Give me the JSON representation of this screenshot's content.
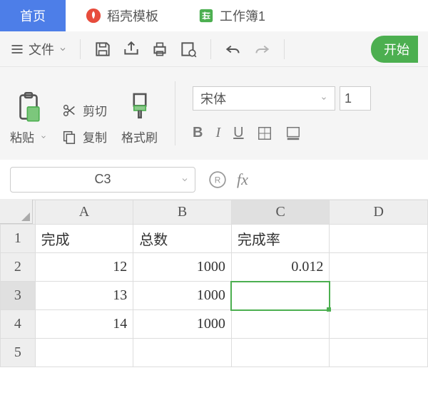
{
  "tabs": {
    "home": "首页",
    "docer": "稻壳模板",
    "workbook": "工作簿1"
  },
  "menu": {
    "file": "文件",
    "start": "开始"
  },
  "ribbon": {
    "paste": "粘贴",
    "cut": "剪切",
    "copy": "复制",
    "format_painter": "格式刷",
    "font_name": "宋体",
    "font_size": "1",
    "bold": "B",
    "italic": "I",
    "underline": "U"
  },
  "namebox": "C3",
  "fx": "fx",
  "columns": [
    "A",
    "B",
    "C",
    "D"
  ],
  "rows": [
    "1",
    "2",
    "3",
    "4",
    "5"
  ],
  "cells": {
    "A1": "完成",
    "B1": "总数",
    "C1": "完成率",
    "A2": "12",
    "B2": "1000",
    "C2": "0.012",
    "A3": "13",
    "B3": "1000",
    "A4": "14",
    "B4": "1000",
    "A5": "",
    "B5": ""
  }
}
